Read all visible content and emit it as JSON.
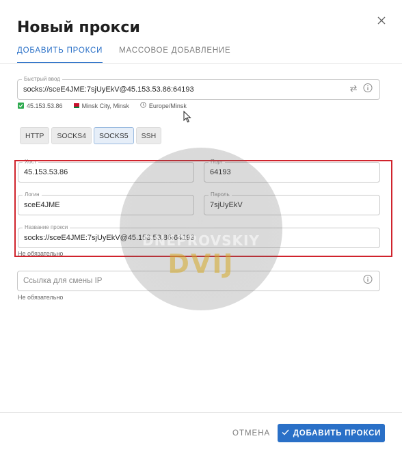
{
  "dialog": {
    "title": "Новый прокси",
    "tabs": [
      {
        "label": "ДОБАВИТЬ ПРОКСИ",
        "active": true
      },
      {
        "label": "МАССОВОЕ ДОБАВЛЕНИЕ",
        "active": false
      }
    ]
  },
  "quick_input": {
    "label": "Быстрый ввод",
    "value": "socks://sceE4JME:7sjUyEkV@45.153.53.86:64193"
  },
  "status": {
    "ip": "45.153.53.86",
    "location": "Minsk City, Minsk",
    "timezone": "Europe/Minsk"
  },
  "protocols": [
    {
      "label": "HTTP",
      "active": false
    },
    {
      "label": "SOCKS4",
      "active": false
    },
    {
      "label": "SOCKS5",
      "active": true
    },
    {
      "label": "SSH",
      "active": false
    }
  ],
  "fields": {
    "host": {
      "label": "Хост",
      "value": "45.153.53.86"
    },
    "port": {
      "label": "Порт",
      "value": "64193"
    },
    "login": {
      "label": "Логин",
      "value": "sceE4JME"
    },
    "password": {
      "label": "Пароль",
      "value": "7sjUyEkV"
    },
    "proxy_name": {
      "label": "Название прокси",
      "value": "socks://sceE4JME:7sjUyEkV@45.153.53.86:64193",
      "hint": "Не обязательно"
    },
    "change_ip_url": {
      "placeholder": "Ссылка для смены IP",
      "hint": "Не обязательно"
    }
  },
  "watermark": {
    "top_text": "DNEPROVSKIY",
    "bottom_text": "DVIJ"
  },
  "footer": {
    "cancel_label": "ОТМЕНА",
    "add_label": "ДОБАВИТЬ ПРОКСИ"
  },
  "colors": {
    "accent": "#2a70c7",
    "highlight": "#d0232c",
    "success": "#2eaa4f"
  }
}
